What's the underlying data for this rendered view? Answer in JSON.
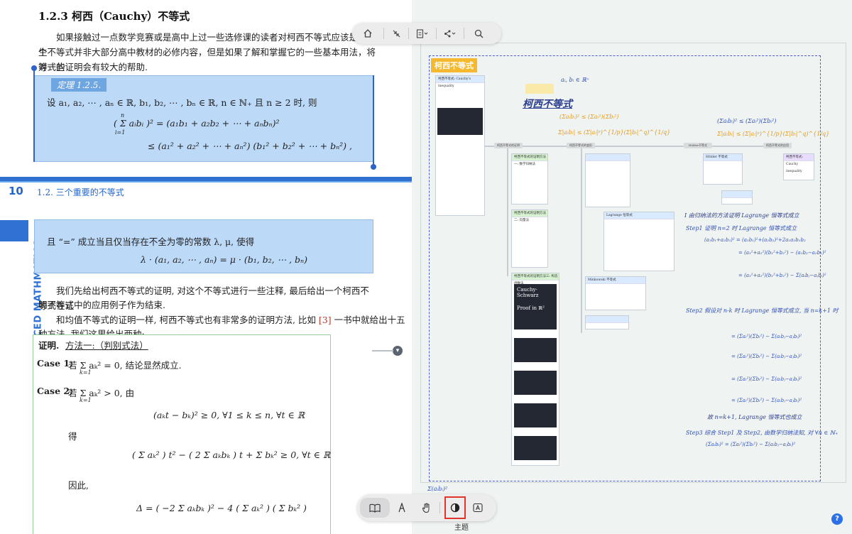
{
  "pdf": {
    "section_heading": "1.2.3   柯西（Cauchy）不等式",
    "intro_paragraph": "如果接触过一点数学竞赛或是高中上过一些选修课的读者对柯西不等式应该是不陌生的，这个不等式并非大部分高中教材的必修内容，但是如果了解和掌握它的一些基本用法，将对一些不等式的证明会有较大的帮助.",
    "intro_line1": "如果接触过一点数学竞赛或是高中上过一些选修课的读者对柯西不等式应该是不陌生",
    "intro_line2": "个不等式并非大部分高中教材的必修内容，但是如果了解和掌握它的一些基本用法，将对一些",
    "intro_line3": "等式的证明会有较大的帮助.",
    "theorem_label": "定理 1.2.5.",
    "theorem_statement": "设 a₁, a₂, ⋯ , aₙ ∈ ℝ, b₁, b₂, ⋯ , bₙ ∈ ℝ, n ∈ ℕ₊ 且 n ≥ 2 时, 则",
    "theorem_formula1": "( Σ aᵢbᵢ )² = (a₁b₁ + a₂b₂ + ⋯ + aₙbₙ)²",
    "theorem_formula2": "≤ (a₁² + a₂² + ⋯ + aₙ²) (b₁² + b₂² + ⋯ + bₙ²) ,",
    "sum_top": "n",
    "sum_bottom": "i=1",
    "page_number": "10",
    "running_head": "1.2.  三个重要的不等式",
    "side_banner": "ADVANCED MATHMATICS",
    "equality_condition": "且 “=” 成立当且仅当存在不全为零的常数 λ, μ, 使得",
    "equality_formula": "λ · (a₁, a₂, ⋯ , aₙ) = μ · (b₁, b₂, ⋯ , bₙ)",
    "body_para1_line1": "我们先给出柯西不等式的证明, 对这个不等式进行一些注释, 最后给出一个柯西不等式在证",
    "body_para1_line2": "明不等式中的应用例子作为结束.",
    "body_para2_line1": "和均值不等式的证明一样, 柯西不等式也有非常多的证明方法, 比如",
    "citation": "[3]",
    "body_para2_line1_tail": "一书中就给出十五",
    "body_para2_line2": "种方法, 我们这里给出两种:",
    "proof_label": "证明.",
    "proof_method": "方法一:（判别式法）",
    "case1_label": "Case 1:",
    "case1_text": "若 Σ aₖ² = 0, 结论显然成立.",
    "case2_label": "Case 2:",
    "case2_text": "若 Σ aₖ² > 0, 由",
    "k_bottom": "k=1",
    "case2_formula": "(aₖt − bₖ)² ≥ 0,    ∀1 ≤ k ≤ n,    ∀t ∈ ℝ",
    "de": "得",
    "quadratic": "( Σ aₖ² ) t² − ( 2 Σ aₖbₖ ) t + Σ bₖ² ≥ 0,    ∀t ∈ ℝ",
    "yinci": "因此,",
    "delta_formula": "Δ = ( −2 Σ aₖbₖ )² − 4 ( Σ aₖ² ) ( Σ bₖ² )"
  },
  "canvas": {
    "frame_title": "柯西不等式",
    "card_title_1": "柯西不等式: Cauchy's inequality",
    "root_note": "柯西不等式",
    "nodes": [
      "柯西不等式的证明",
      "柯西不等式的变形",
      "Hölder不等式",
      "柯西不等式的应用"
    ],
    "cards": [
      {
        "title": "柯西不等式的证明方法一: 数学归纳法"
      },
      {
        "title": "柯西不等式的证明方法二: 向量法"
      },
      {
        "title": "柯西不等式的证明方法三: 构造函数法"
      },
      {
        "title": "Lagrange 恒等式"
      },
      {
        "title": "Minkowski 不等式"
      },
      {
        "title": "Hölder 不等式"
      },
      {
        "title": "柯西不等式: Cauchy inequality"
      }
    ],
    "handwriting": {
      "h_title": "柯西不等式",
      "step1": "Step1  证明 n=2 时 Lagrange 恒等式成立",
      "step2": "Step2  假设对 n-k 时 Lagrange 恒等式成立, 当 n=k+1 时",
      "step3": "Step3  综合 Step1 及 Step2, 由数学归纳法知, 对 ∀n ∈ ℕ₊",
      "induction_intro": "Ⅰ 由归纳法的方法证明 Lagrange 恒等式成立",
      "conclusion": "故 n=k+1, Lagrange 恒等式也成立"
    },
    "video_caption": "Cauchy-Schwarz",
    "video_caption2": "Proof in ℝ²",
    "left_footer_sum": "Σ(aᵢbᵢ)²"
  },
  "top_toolbar": {
    "icons": [
      "home-icon",
      "collapse-arrows-icon",
      "document-icon",
      "share-icon",
      "search-icon"
    ]
  },
  "bottom_toolbar": {
    "icons": [
      "book-icon",
      "pen-icon",
      "hand-icon",
      "theme-icon",
      "text-recognition-icon"
    ],
    "tooltip": "主题",
    "active": "theme-icon"
  },
  "help_label": "?"
}
